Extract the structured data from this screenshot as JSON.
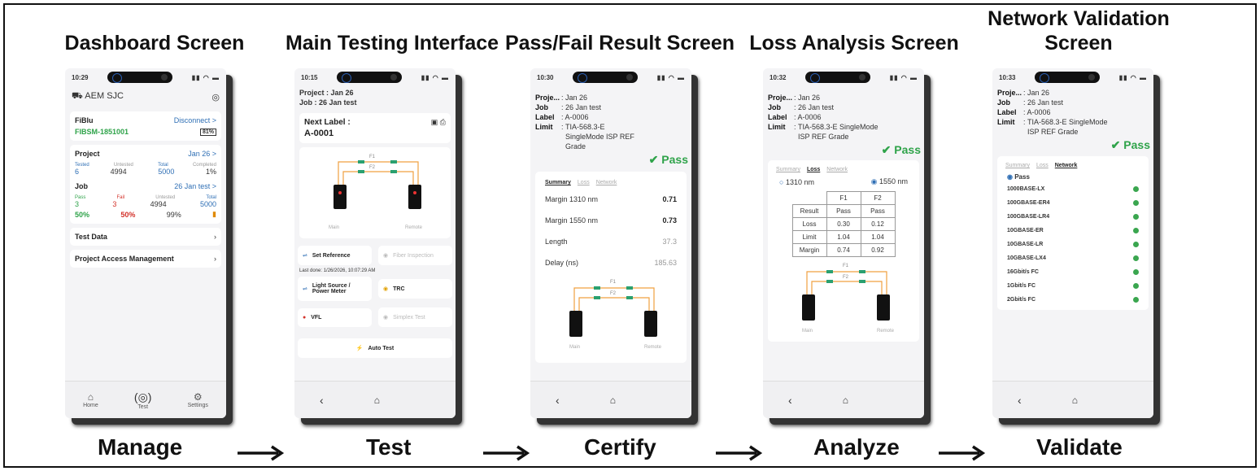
{
  "stages": [
    {
      "title": "Dashboard Screen",
      "foot": "Manage"
    },
    {
      "title": "Main Testing Interface",
      "foot": "Test"
    },
    {
      "title": "Pass/Fail Result Screen",
      "foot": "Certify"
    },
    {
      "title": "Loss Analysis Screen",
      "foot": "Analyze"
    },
    {
      "title": "Network Validation Screen",
      "foot": "Validate"
    }
  ],
  "dashboard": {
    "time": "10:29",
    "org": "AEM SJC",
    "device": "FiBlu",
    "device_id": "FIBSM-1851001",
    "disconnect": "Disconnect >",
    "battery": "81%",
    "project_label": "Project",
    "project_value": "Jan 26 >",
    "p_heads": [
      "Tested",
      "Untested",
      "Total",
      "Completed"
    ],
    "p_vals": [
      "6",
      "4994",
      "5000",
      "1%"
    ],
    "job_label": "Job",
    "job_value": "26 Jan test >",
    "j_heads": [
      "Pass",
      "Fail",
      "Untested",
      "Total"
    ],
    "j_vals": [
      "3",
      "3",
      "4994",
      "5000"
    ],
    "j_pcts": [
      "50%",
      "50%",
      "99%"
    ],
    "test_data": "Test Data",
    "access": "Project Access Management",
    "nav": [
      "Home",
      "Test",
      "Settings"
    ]
  },
  "testing": {
    "time": "10:15",
    "project": "Project : Jan 26",
    "job": "Job      : 26 Jan test",
    "next_label": "Next Label :",
    "label_val": "A-0001",
    "f1": "F1",
    "f2": "F2",
    "main": "Main",
    "remote": "Remote",
    "set_ref": "Set Reference",
    "fiber_insp": "Fiber Inspection",
    "last_done": "Last done: 1/26/2026, 10:07:29 AM",
    "lspm": "Light Source / Power Meter",
    "trc": "TRC",
    "vfl": "VFL",
    "simplex": "Simplex Test",
    "auto": "Auto Test"
  },
  "result": {
    "time": "10:30",
    "project": "Jan 26",
    "job": "26 Jan test",
    "label": "A-0006",
    "limit": "TIA-568.3-E SingleMode ISP REF Grade",
    "pass": "Pass",
    "tabs": [
      "Summary",
      "Loss",
      "Network"
    ],
    "rows": [
      [
        "Margin 1310 nm",
        "0.71"
      ],
      [
        "Margin 1550 nm",
        "0.73"
      ],
      [
        "Length",
        "37.3"
      ],
      [
        "Delay (ns)",
        "185.63"
      ]
    ],
    "f1": "F1",
    "f2": "F2",
    "main": "Main",
    "remote": "Remote"
  },
  "loss": {
    "time": "10:32",
    "project": "Jan 26",
    "job": "26 Jan test",
    "label": "A-0006",
    "limit": "TIA-568.3-E SingleMode ISP REF Grade",
    "pass": "Pass",
    "tabs": [
      "Summary",
      "Loss",
      "Network"
    ],
    "wl": [
      "1310 nm",
      "1550 nm"
    ],
    "heads": [
      "",
      "F1",
      "F2"
    ],
    "rows": [
      [
        "Result",
        "Pass",
        "Pass"
      ],
      [
        "Loss",
        "0.30",
        "0.12"
      ],
      [
        "Limit",
        "1.04",
        "1.04"
      ],
      [
        "Margin",
        "0.74",
        "0.92"
      ]
    ],
    "f1": "F1",
    "f2": "F2",
    "main": "Main",
    "remote": "Remote"
  },
  "network": {
    "time": "10:33",
    "project": "Jan 26",
    "job": "26 Jan test",
    "label": "A-0006",
    "limit": "TIA-568.3-E SingleMode ISP REF Grade",
    "pass": "Pass",
    "tabs": [
      "Summary",
      "Loss",
      "Network"
    ],
    "radio": "Pass",
    "items": [
      "1000BASE-LX",
      "100GBASE-ER4",
      "100GBASE-LR4",
      "10GBASE-ER",
      "10GBASE-LR",
      "10GBASE-LX4",
      "16Gbit/s FC",
      "1Gbit/s FC",
      "2Gbit/s FC"
    ]
  },
  "colors": {
    "pass": "#2fa34a",
    "fail": "#d3322a",
    "accent": "#2f6fb5",
    "fiber": "#f0a040"
  }
}
